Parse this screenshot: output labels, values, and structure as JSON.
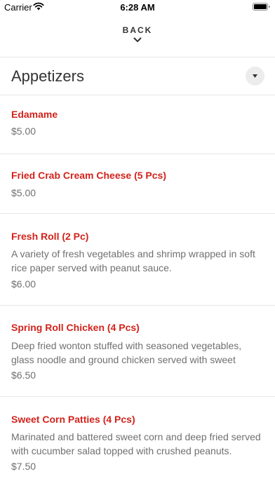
{
  "status_bar": {
    "carrier": "Carrier",
    "time": "6:28 AM",
    "wifi_icon": "wifi-icon",
    "battery_icon": "battery-icon"
  },
  "nav": {
    "back_label": "BACK",
    "back_icon": "chevron-down-icon"
  },
  "section": {
    "title": "Appetizers",
    "toggle_icon": "caret-down-icon"
  },
  "items": [
    {
      "name": "Edamame",
      "description": "",
      "price": "$5.00"
    },
    {
      "name": "Fried Crab Cream Cheese (5 Pcs)",
      "description": "",
      "price": "$5.00"
    },
    {
      "name": "Fresh Roll (2 Pc)",
      "description": "A variety of fresh vegetables and shrimp wrapped in soft rice paper served with peanut sauce.",
      "price": "$6.00"
    },
    {
      "name": "Spring Roll Chicken (4 Pcs)",
      "description": "Deep fried wonton stuffed with seasoned vegetables, glass noodle and ground chicken served with sweet and…",
      "price": "$6.50"
    },
    {
      "name": "Sweet Corn Patties (4 Pcs)",
      "description": "Marinated and battered sweet corn and deep fried served with cucumber salad topped with crushed peanuts.",
      "price": "$7.50"
    }
  ],
  "colors": {
    "item_name": "#d2231c",
    "secondary_text": "#707070",
    "divider": "#e6e6e6"
  }
}
